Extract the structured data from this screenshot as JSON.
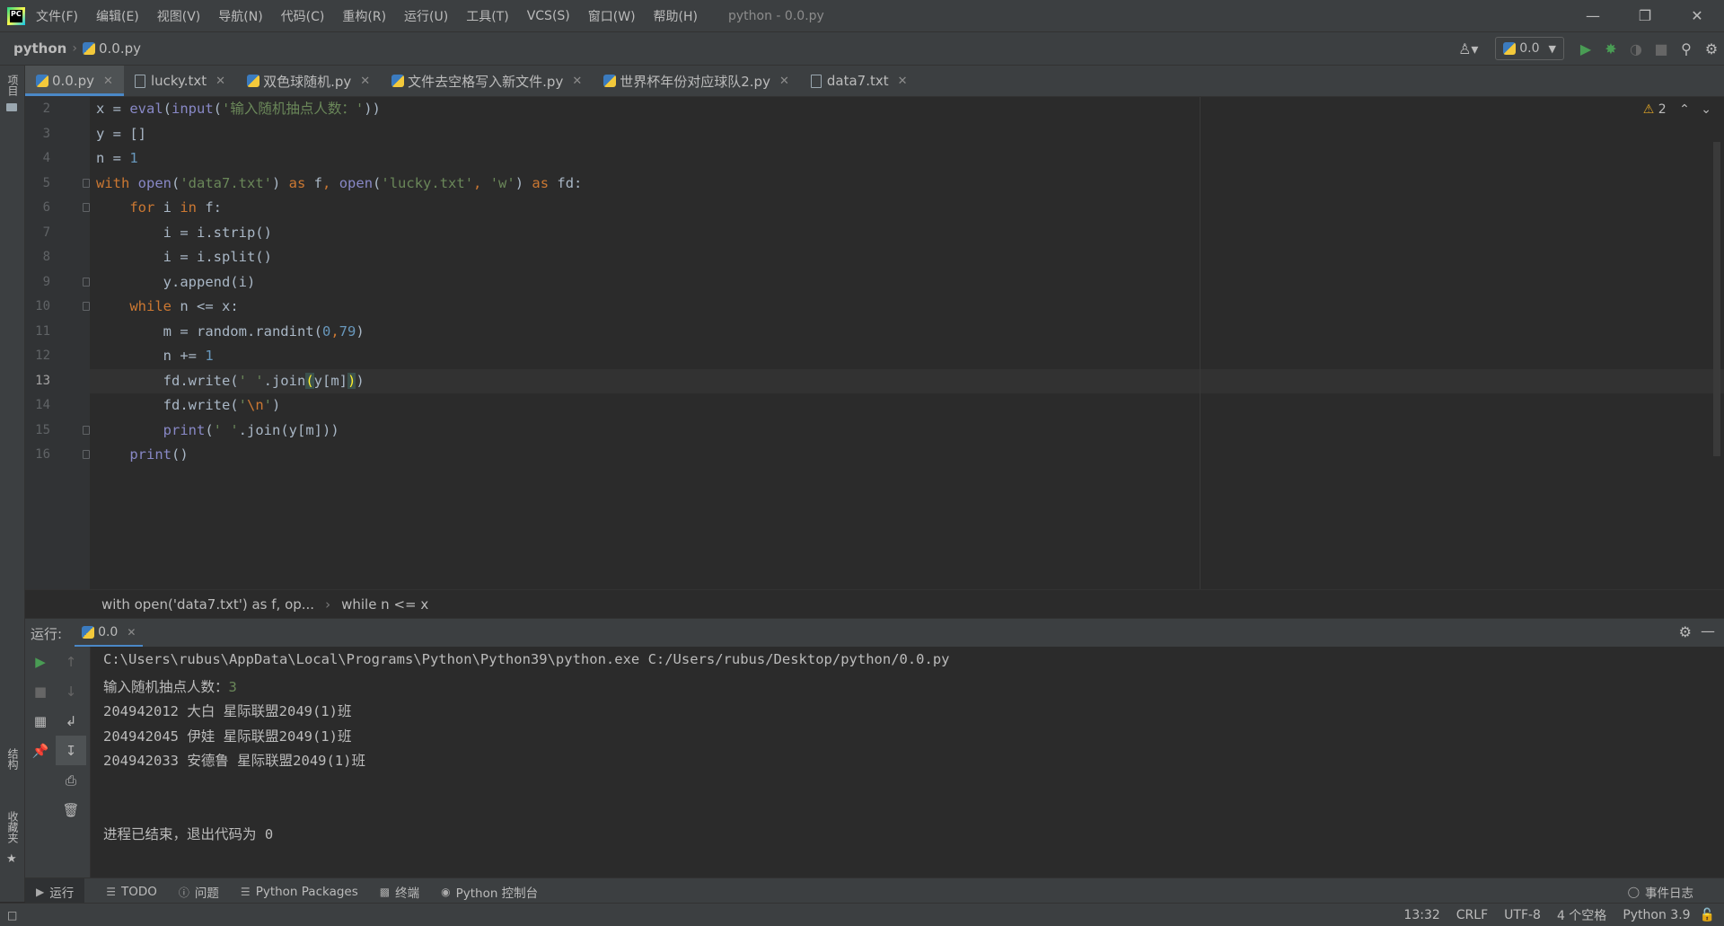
{
  "menubar": {
    "items": [
      "文件(F)",
      "编辑(E)",
      "视图(V)",
      "导航(N)",
      "代码(C)",
      "重构(R)",
      "运行(U)",
      "工具(T)",
      "VCS(S)",
      "窗口(W)",
      "帮助(H)"
    ],
    "window_title": "python - 0.0.py"
  },
  "navbar": {
    "project": "python",
    "file": "0.0.py",
    "run_config": "0.0"
  },
  "left_stripe": {
    "project": "项目",
    "structure": "结构",
    "favorites": "收藏夹"
  },
  "tabs": [
    {
      "label": "0.0.py"
    },
    {
      "label": "lucky.txt"
    },
    {
      "label": "双色球随机.py"
    },
    {
      "label": "文件去空格写入新文件.py"
    },
    {
      "label": "世界杯年份对应球队2.py"
    },
    {
      "label": "data7.txt"
    }
  ],
  "editor": {
    "warnings": "2",
    "line_numbers": [
      "2",
      "3",
      "4",
      "5",
      "6",
      "7",
      "8",
      "9",
      "10",
      "11",
      "12",
      "13",
      "14",
      "15",
      "16"
    ]
  },
  "breadcrumbs": [
    "with open('data7.txt') as f, op...",
    "while n <= x"
  ],
  "run_panel": {
    "label": "运行:",
    "tab": "0.0",
    "console": [
      "C:\\Users\\rubus\\AppData\\Local\\Programs\\Python\\Python39\\python.exe C:/Users/rubus/Desktop/python/0.0.py",
      "输入随机抽点人数：",
      "204942012 大白 星际联盟2049(1)班",
      "204942045 伊娃 星际联盟2049(1)班",
      "204942033 安德鲁 星际联盟2049(1)班",
      "进程已结束，退出代码为 0"
    ],
    "input_value": "3"
  },
  "bottom_tools": [
    "运行",
    "TODO",
    "问题",
    "Python Packages",
    "终端",
    "Python 控制台"
  ],
  "event_log": "事件日志",
  "status": {
    "position": "13:32",
    "line_sep": "CRLF",
    "encoding": "UTF-8",
    "indent": "4 个空格",
    "interpreter": "Python 3.9"
  }
}
